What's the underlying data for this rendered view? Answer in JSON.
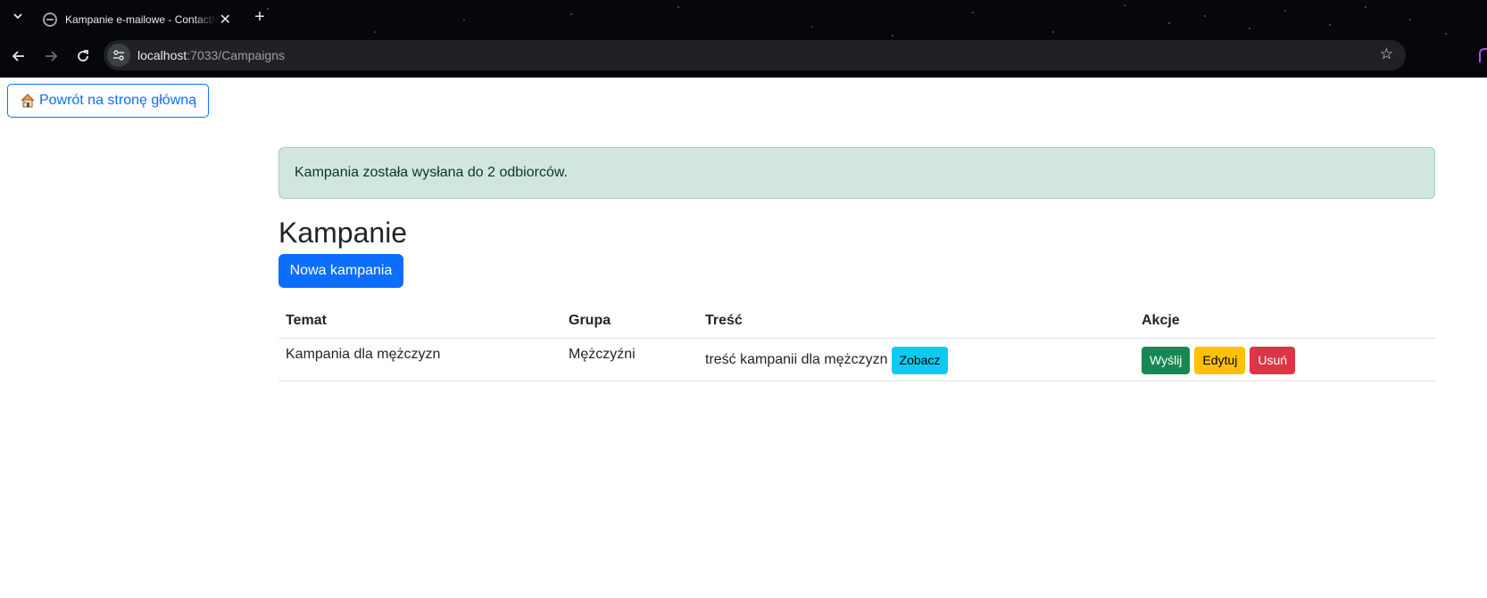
{
  "browser": {
    "tab_title": "Kampanie e-mailowe - ContactManager",
    "url_host": "localhost",
    "url_path": ":7033/Campaigns"
  },
  "page": {
    "back_button": "Powrót na stronę główną",
    "back_icon": "house-icon",
    "alert_message": "Kampania została wysłana do 2 odbiorców.",
    "title": "Kampanie",
    "new_campaign_button": "Nowa kampania"
  },
  "table": {
    "headers": [
      "Temat",
      "Grupa",
      "Treść",
      "Akcje"
    ],
    "rows": [
      {
        "subject": "Kampania dla mężczyzn",
        "group": "Mężczyźni",
        "content": "treść kampanii dla mężczyzn",
        "view_label": "Zobacz",
        "send_label": "Wyślij",
        "edit_label": "Edytuj",
        "delete_label": "Usuń"
      }
    ]
  },
  "colors": {
    "primary": "#0d6efd",
    "success": "#198754",
    "warning": "#ffc107",
    "danger": "#dc3545",
    "info": "#0dcaf0",
    "alert_bg": "#d1e7dd"
  }
}
